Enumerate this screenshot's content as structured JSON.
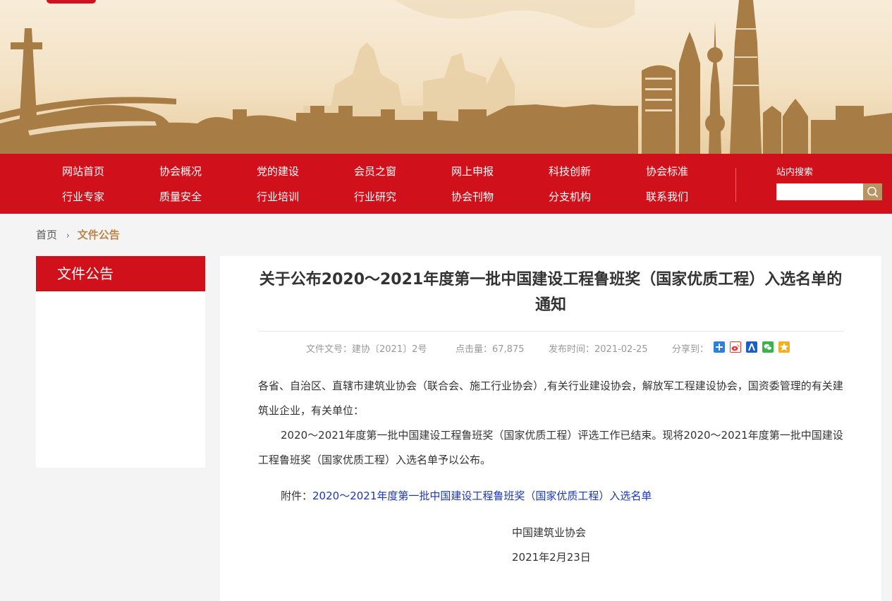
{
  "nav": {
    "row1": [
      "网站首页",
      "协会概况",
      "党的建设",
      "会员之窗",
      "网上申报",
      "科技创新",
      "协会标准"
    ],
    "row2": [
      "行业专家",
      "质量安全",
      "行业培训",
      "行业研究",
      "协会刊物",
      "分支机构",
      "联系我们"
    ],
    "search_label": "站内搜索",
    "search_value": ""
  },
  "breadcrumb": {
    "home": "首页",
    "current": "文件公告"
  },
  "sidebar": {
    "title": "文件公告"
  },
  "article": {
    "title": "关于公布2020～2021年度第一批中国建设工程鲁班奖（国家优质工程）入选名单的通知",
    "doc_no": "文件文号：建协〔2021〕2号",
    "views": "点击量：67,875",
    "publish_time": "发布时间：2021-02-25",
    "share_label": "分享到：",
    "share_icons": [
      "share-more-icon",
      "weibo-icon",
      "renren-icon",
      "wechat-icon",
      "qzone-icon"
    ],
    "para1": "各省、自治区、直辖市建筑业协会（联合会、施工行业协会）,有关行业建设协会，解放军工程建设协会，国资委管理的有关建筑业企业，有关单位：",
    "para2": "2020～2021年度第一批中国建设工程鲁班奖（国家优质工程）评选工作已结束。现将2020～2021年度第一批中国建设工程鲁班奖（国家优质工程）入选名单予以公布。",
    "attach_label": "附件：",
    "attach_link": "2020～2021年度第一批中国建设工程鲁班奖（国家优质工程）入选名单",
    "signature": "中国建筑业协会",
    "date": "2021年2月23日"
  },
  "colors": {
    "nav_red": "#d0111b",
    "banner_gold": "#a77d45",
    "breadcrumb_accent": "#b8864a",
    "link_blue": "#1b37b8"
  }
}
